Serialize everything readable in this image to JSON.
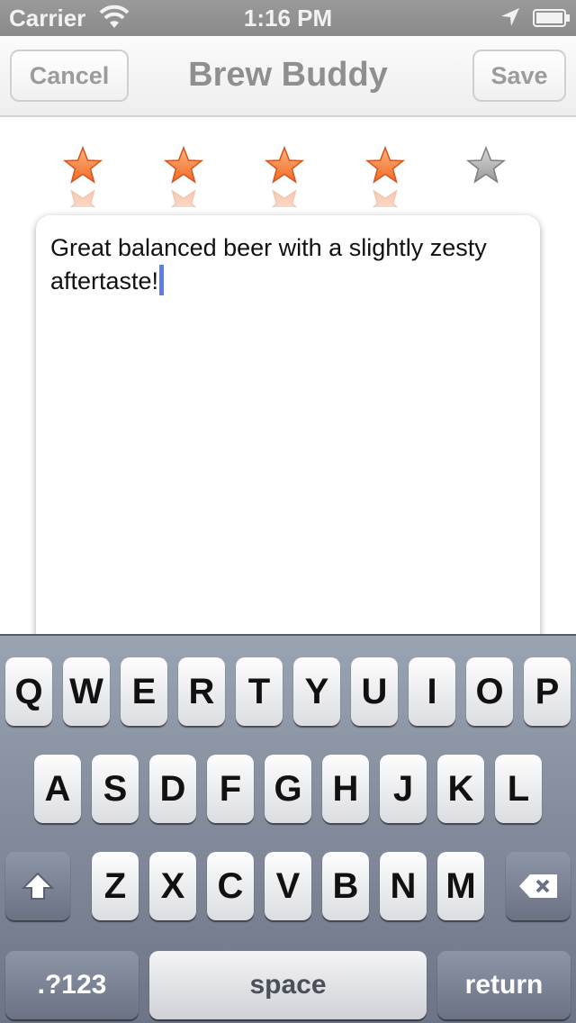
{
  "status_bar": {
    "carrier": "Carrier",
    "time": "1:16 PM"
  },
  "nav": {
    "cancel_label": "Cancel",
    "title": "Brew Buddy",
    "save_label": "Save"
  },
  "rating": {
    "value": 4,
    "max": 5
  },
  "note": {
    "text": "Great balanced beer with a slightly zesty\naftertaste!"
  },
  "keyboard": {
    "row1": [
      "Q",
      "W",
      "E",
      "R",
      "T",
      "Y",
      "U",
      "I",
      "O",
      "P"
    ],
    "row2": [
      "A",
      "S",
      "D",
      "F",
      "G",
      "H",
      "J",
      "K",
      "L"
    ],
    "row3": [
      "Z",
      "X",
      "C",
      "V",
      "B",
      "N",
      "M"
    ],
    "numbers_label": ".?123",
    "space_label": "space",
    "return_label": "return"
  },
  "colors": {
    "star_active": "#f26a2a",
    "star_inactive": "#9a9a9a",
    "caret": "#5a7fe8"
  }
}
